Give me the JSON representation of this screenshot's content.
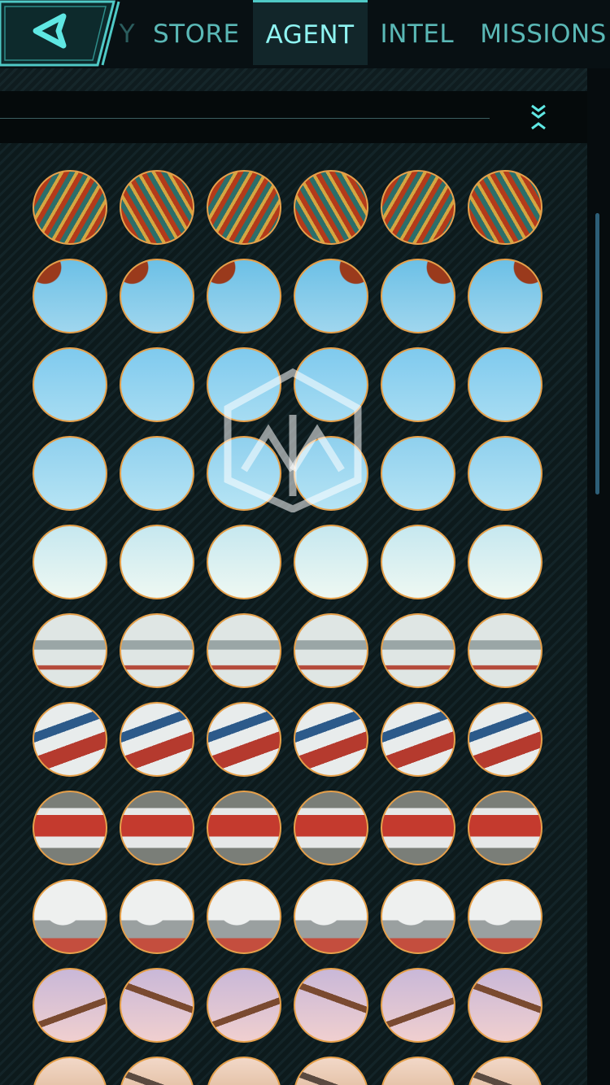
{
  "nav": {
    "tabs": [
      {
        "label": "Y",
        "state": "partial"
      },
      {
        "label": "STORE",
        "state": "normal"
      },
      {
        "label": "AGENT",
        "state": "active"
      },
      {
        "label": "INTEL",
        "state": "normal"
      },
      {
        "label": "MISSIONS",
        "state": "normal"
      }
    ],
    "back_icon": "back-arrow-icon",
    "collapse_icon": "double-chevron-collapse-icon"
  },
  "colors": {
    "accent": "#4fc9c6",
    "tab_text": "#5ab8b6",
    "tab_active_text": "#8ff4f2",
    "badge_border": "#e6a04a"
  },
  "medals": {
    "visible_rows": 11,
    "columns": 6,
    "rows": [
      {
        "theme": "painted-eaves",
        "colors": [
          "#b33a1a",
          "#2c6e6a",
          "#d4a640"
        ]
      },
      {
        "theme": "eaves-sky",
        "colors": [
          "#9fd6ee",
          "#6cc0e6",
          "#9a3a1c"
        ]
      },
      {
        "theme": "sky",
        "colors": [
          "#a6dcf2",
          "#7fcaee"
        ]
      },
      {
        "theme": "sky",
        "colors": [
          "#b6e4f4",
          "#8fd0ee"
        ]
      },
      {
        "theme": "pale-sky",
        "colors": [
          "#eef8f2",
          "#c6e8f0"
        ]
      },
      {
        "theme": "snowy-city",
        "colors": [
          "#dfe6e4",
          "#9aa6a6",
          "#b44a3a"
        ]
      },
      {
        "theme": "snowy-roofs",
        "colors": [
          "#e8ecec",
          "#b53a2e",
          "#2c5a8a"
        ]
      },
      {
        "theme": "red-walls",
        "colors": [
          "#c43a2e",
          "#e6e8e8",
          "#7a7e78"
        ]
      },
      {
        "theme": "snowy-trees",
        "colors": [
          "#eef0ef",
          "#9aa0a0",
          "#c44e3e"
        ]
      },
      {
        "theme": "industrial-dusk",
        "colors": [
          "#c9b8d8",
          "#f0cfcf",
          "#7a4a30"
        ]
      },
      {
        "theme": "industrial-warm",
        "colors": [
          "#f2d8c8",
          "#d2a47a",
          "#5a4a40"
        ]
      }
    ]
  }
}
